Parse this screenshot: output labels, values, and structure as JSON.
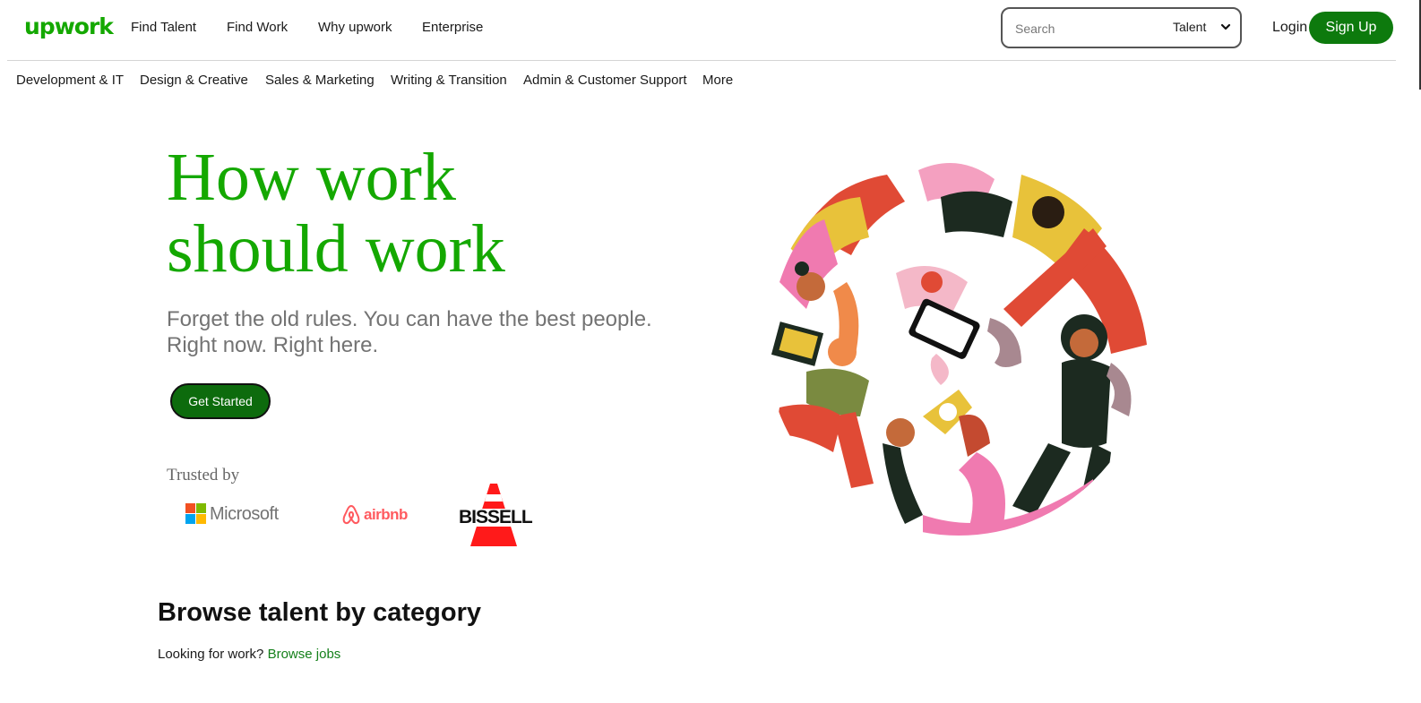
{
  "brand": {
    "logo_text": "upwork",
    "primary_color": "#14a800",
    "button_color": "#0d7a0d"
  },
  "nav": {
    "items": [
      "Find Talent",
      "Find Work",
      "Why upwork",
      "Enterprise"
    ],
    "search": {
      "placeholder": "Search",
      "type": "Talent"
    },
    "login": "Login",
    "signup": "Sign Up"
  },
  "categories": [
    "Development & IT",
    "Design & Creative",
    "Sales & Marketing",
    "Writing & Transition",
    "Admin & Customer Support",
    "More"
  ],
  "hero": {
    "title_line1": "How work",
    "title_line2": "should work",
    "subtitle_line1": "Forget the old rules. You can have the best people.",
    "subtitle_line2": "Right now. Right here.",
    "cta": "Get Started"
  },
  "trusted": {
    "label": "Trusted by",
    "logos": [
      "Microsoft",
      "airbnb",
      "BISSELL"
    ]
  },
  "browse": {
    "title": "Browse talent by category",
    "prompt": "Looking for work?",
    "link": "Browse jobs"
  }
}
